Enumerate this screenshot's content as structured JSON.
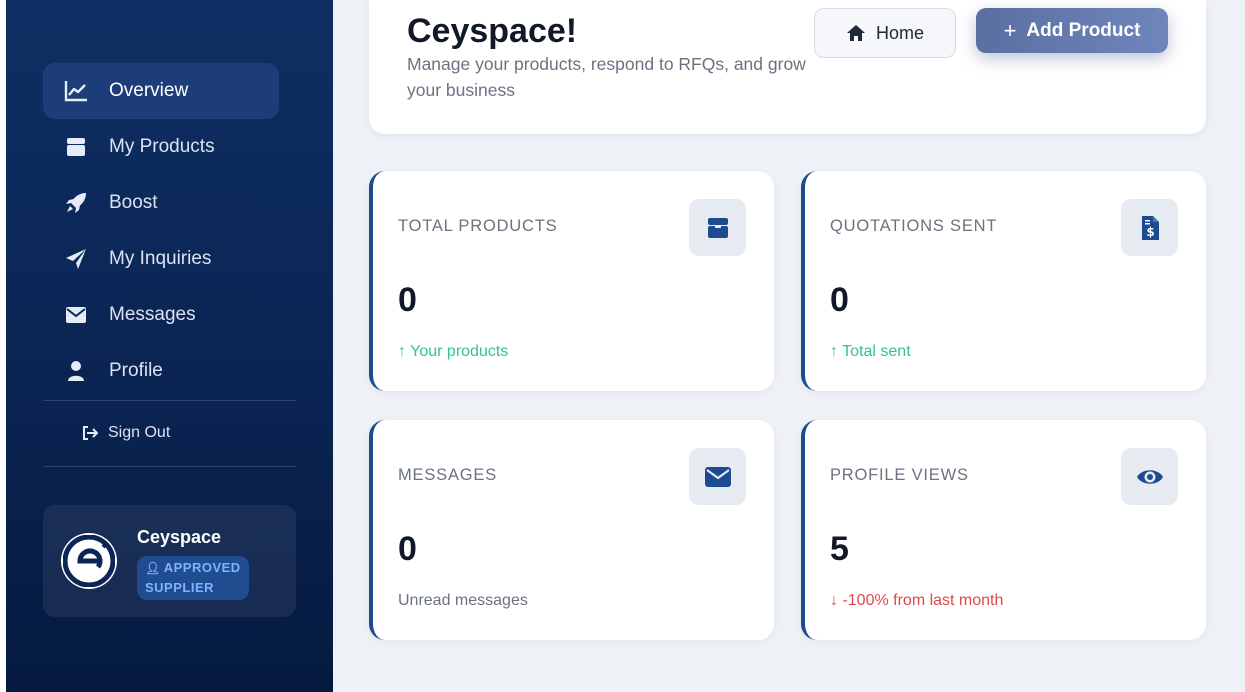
{
  "sidebar": {
    "items": [
      {
        "label": "Overview",
        "icon": "chart-line-icon",
        "active": true
      },
      {
        "label": "My Products",
        "icon": "box-icon"
      },
      {
        "label": "Boost",
        "icon": "rocket-icon"
      },
      {
        "label": "My Inquiries",
        "icon": "paper-plane-icon"
      },
      {
        "label": "Messages",
        "icon": "envelope-icon"
      },
      {
        "label": "Profile",
        "icon": "user-icon"
      }
    ],
    "signout_label": "Sign Out",
    "profile": {
      "name": "Ceyspace",
      "badge": "APPROVED SUPPLIER"
    }
  },
  "header": {
    "title": "Ceyspace!",
    "subtitle": "Manage your products, respond to RFQs, and grow your business",
    "home_label": "Home",
    "add_label": "Add Product"
  },
  "stats": [
    {
      "label": "TOTAL PRODUCTS",
      "value": "0",
      "note": "↑ Your products",
      "note_type": "up",
      "icon": "box-icon"
    },
    {
      "label": "QUOTATIONS SENT",
      "value": "0",
      "note": "↑ Total sent",
      "note_type": "up",
      "icon": "invoice-dollar-icon"
    },
    {
      "label": "MESSAGES",
      "value": "0",
      "note": "Unread messages",
      "note_type": "neutral",
      "icon": "envelope-icon"
    },
    {
      "label": "PROFILE VIEWS",
      "value": "5",
      "note": "↓ -100% from last month",
      "note_type": "down",
      "icon": "eye-icon"
    }
  ],
  "colors": {
    "sidebar_bg": "#0b2554",
    "accent": "#1e4b8f",
    "positive": "#34c38f",
    "negative": "#e0484a"
  }
}
